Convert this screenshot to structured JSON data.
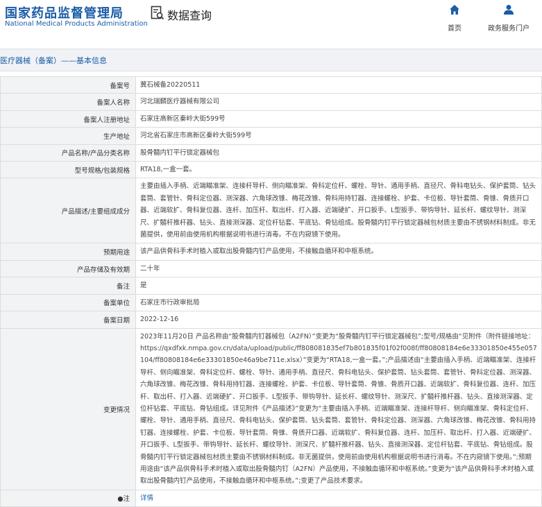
{
  "header": {
    "logo_cn": "国家药品监督管理局",
    "logo_en": "National Medical Products Administration",
    "query_label": "数据查询",
    "nav": [
      {
        "label": "首页",
        "icon": "home-icon"
      },
      {
        "label": "政务服务门户",
        "icon": "user-icon"
      }
    ]
  },
  "breadcrumb": "医疗器械（备案）——基本信息",
  "colors": {
    "brand": "#1a5ca8",
    "label_bg": "#f2f3f5",
    "border": "#dcdcdc"
  },
  "rows": [
    {
      "label": "备案号",
      "value": "冀石械备20220511"
    },
    {
      "label": "备案人名称",
      "value": "河北瑞麟医疗器械有限公司"
    },
    {
      "label": "备案人注册地址",
      "value": "石家庄高新区秦岭大街599号"
    },
    {
      "label": "生产地址",
      "value": "河北省石家庄市高新区秦岭大街599号"
    },
    {
      "label": "产品名称/产品分类名称",
      "value": "股骨髓内钉平行锁定器械包"
    },
    {
      "label": "型号规格/包装规格",
      "value": "RTA18,一盒一套。"
    },
    {
      "label": "产品描述/主要组成成分",
      "value": "主要由插入手柄、近端瞄准架、连接杆导杆、侧向瞄准架、骨科定位杆、螺栓、导针、通用手柄、直径尺、骨科电钻头、保护套筒、钻头套筒、套管针、骨科定位器、测深器、六角球改锥、梅花改锥、骨科用持钉器、连接螺栓、护套、卡位板、导针套筒、骨锥、骨质开口器、近端软扩、骨科复位器、连杆、加压杆、取出杆、打入器、近端硬扩、开口扳手、L型扳手、带钩导针、延长杆、螺纹导针、测深尺、扩髓杆推杆器、钻头、直接测深器、定位杆钻套、平底钻、骨钻组成。股骨髓内钉平行锁定器械包材质主要由不锈钢材料制成。非无菌提供，使用前由使用机构根据说明书进行消毒。不在内窥镜下使用。"
    },
    {
      "label": "预期用途",
      "value": "该产品供骨科手术时植入或取出股骨髓内钉产品使用，不接触血循环和中枢系统。"
    },
    {
      "label": "产品存储及有效期",
      "value": "二十年"
    },
    {
      "label": "备注",
      "value": "是"
    },
    {
      "label": "备案单位",
      "value": "石家庄市行政审批局"
    },
    {
      "label": "备案日期",
      "value": "2022-12-16"
    },
    {
      "label": "变更情况",
      "value": "2023年11月20日 产品名称由“股骨髓内钉器械包（A2FN）”变更为“股骨髓内钉平行锁定器械包”;型号/规格由“见附件（附件链接地址：https://qxdfxk.nmpa.gov.cn/data/upload/public/ff808081835ef7b801835f01f02f008f/ff80808184e6e33301850e455e057104/ff80808184e6e33301850e46a9be711e.xlsx）”变更为“RTA18,一盒一套。”;产品描述由“主要由插入手柄、近端瞄准架、连接杆导杆、侧向瞄准架、骨科定位杆、螺栓、导针、通用手柄、直径尺、骨科电钻头、保护套筒、钻头套筒、套管针、骨科定位器、测深器、六角球改锥、梅花改锥、骨科用持钉器、连接螺栓、护套、卡位板、导针套筒、骨锥、骨质开口器、近端软扩、骨科复位器、连杆、加压杆、取出杆、打入器、近端硬扩、开口扳手、L型扳手、带钩导针、延长杆、螺纹导针、测深尺、扩髓杆推杆器、钻头、直接测深器、定位杆钻套、平底钻、骨钻组成。详见附件《产品描述》”变更为“主要由插入手柄、近端瞄准架、连接杆导杆、侧向瞄准架、骨科定位杆、螺栓、导针、通用手柄、直径尺、骨科电钻头、保护套筒、钻头套筒、套管针、骨科定位器、测深器、六角球改锥、梅花改锥、骨科用持钉器、连接螺栓、护套、卡位板、导针套筒、骨锥、骨质开口器、近端软扩、骨科复位器、连杆、加压杆、取出杆、打入器、近端硬扩、开口扳手、L型扳手、带钩导针、延长杆、螺纹导针、测深尺、扩髓杆推杆器、钻头、直接测深器、定位杆钻套、平底钻、骨钻组成。股骨髓内钉平行锁定器械包材质主要由不锈钢材料制成。非无菌提供，使用前由使用机构根据说明书进行消毒。不在内窥镜下使用。”;预期用途由“该产品供骨科手术时植入或取出股骨髓内钉（A2FN）产品使用，不接触血循环和中枢系统。”变更为“该产品供骨科手术时植入或取出股骨髓内钉产品使用，不接触血循环和中枢系统。”;变更了产品技术要求。"
    }
  ],
  "note_row": {
    "label": "●注",
    "link": "详情"
  }
}
